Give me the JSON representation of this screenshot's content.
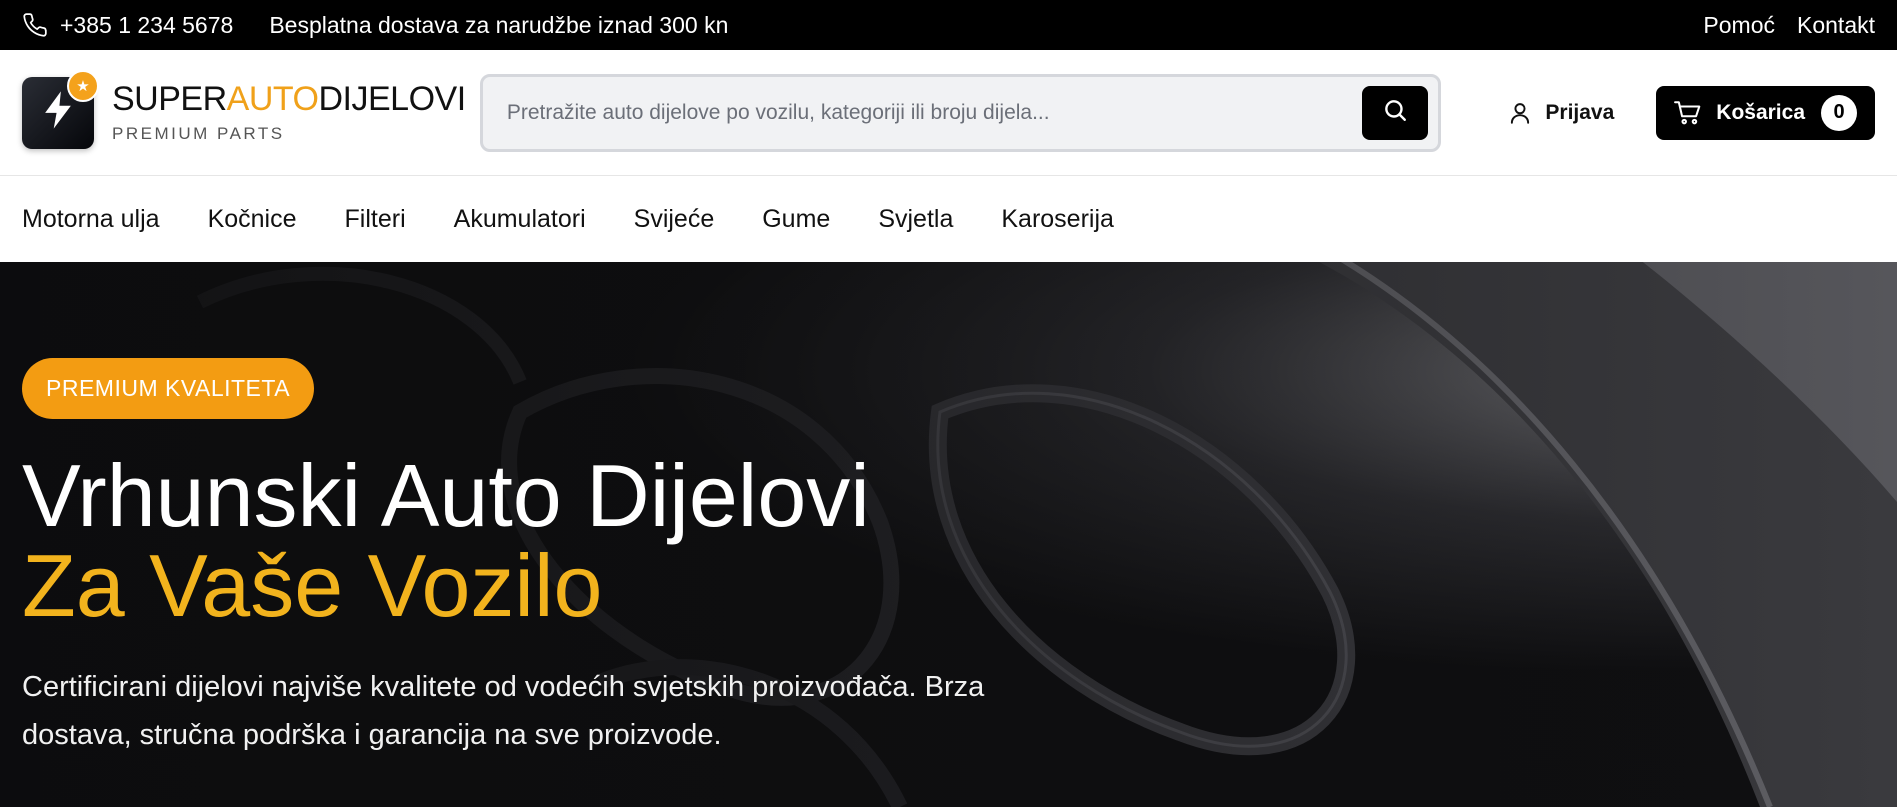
{
  "topbar": {
    "phone": "+385 1 234 5678",
    "shipping": "Besplatna dostava za narudžbe iznad 300 kn",
    "links": [
      "Pomoć",
      "Kontakt"
    ]
  },
  "logo": {
    "name_part1": "SUPER",
    "name_part2": "AUTO",
    "name_part3": "DIJELOVI",
    "subtitle": "PREMIUM PARTS"
  },
  "search": {
    "placeholder": "Pretražite auto dijelove po vozilu, kategoriji ili broju dijela...",
    "value": ""
  },
  "account": {
    "login_label": "Prijava"
  },
  "cart": {
    "label": "Košarica",
    "count": "0"
  },
  "nav": {
    "items": [
      "Motorna ulja",
      "Kočnice",
      "Filteri",
      "Akumulatori",
      "Svijeće",
      "Gume",
      "Svjetla",
      "Karoserija"
    ]
  },
  "hero": {
    "badge": "PREMIUM KVALITETA",
    "title_line1": "Vrhunski Auto Dijelovi",
    "title_line2": "Za Vaše Vozilo",
    "description": "Certificirani dijelovi najviše kvalitete od vodećih svjetskih proizvođača. Brza dostava, stručna podrška i garancija na sve proizvode."
  },
  "colors": {
    "accent": "#f39c12",
    "accent_text": "#f2b31d",
    "topbar_bg": "#000000"
  },
  "icons": [
    "phone-icon",
    "bolt-icon",
    "star-icon",
    "search-icon",
    "user-icon",
    "cart-icon"
  ]
}
